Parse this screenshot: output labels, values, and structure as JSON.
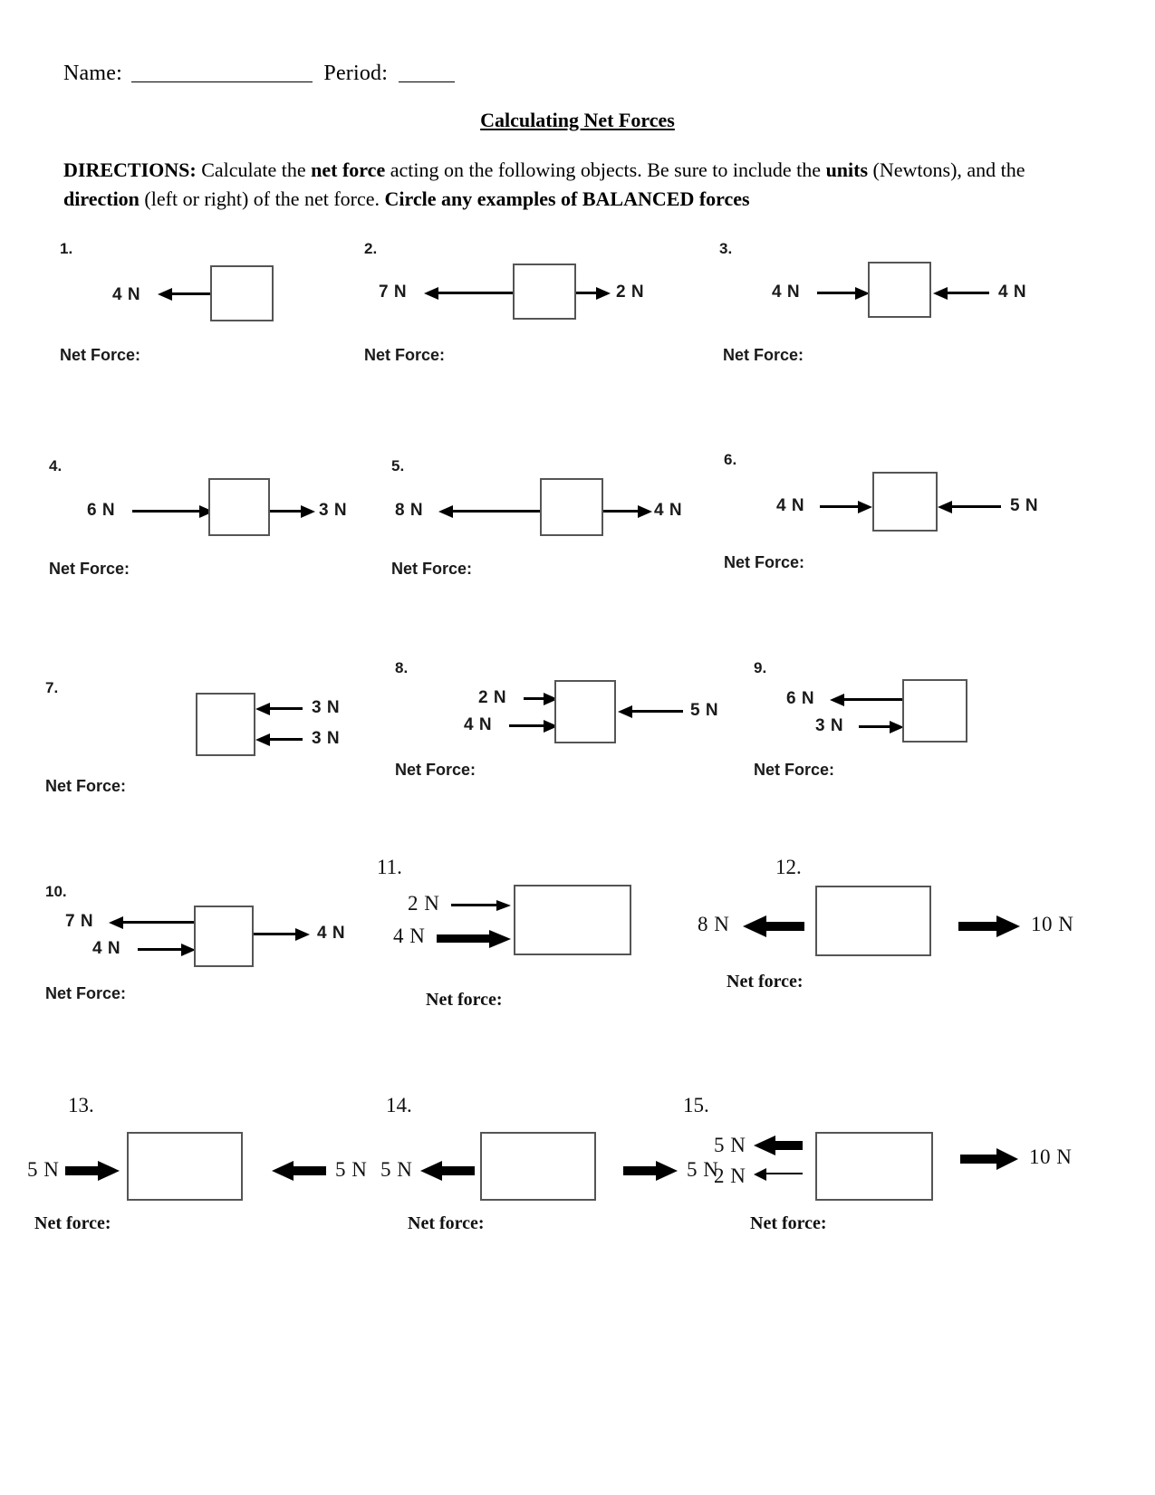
{
  "header": {
    "name_label": "Name:",
    "period_label": "Period:",
    "title": "Calculating Net Forces",
    "directions_prefix": "DIRECTIONS:",
    "directions_part1": " Calculate the ",
    "directions_bold1": "net force",
    "directions_part2": " acting on the following objects. Be sure to include the ",
    "directions_bold2": "units",
    "directions_part3": " (Newtons), and the ",
    "directions_bold3": "direction",
    "directions_part4": " (left or right) of the net force. ",
    "directions_bold4": "Circle any examples of BALANCED forces"
  },
  "labels": {
    "net_force_caps": "Net Force:",
    "net_force_lower": "Net force:"
  },
  "problems": [
    {
      "number": "1.",
      "style": "sans",
      "net_force_label": "Net Force:",
      "forces": [
        {
          "magnitude": "4 N",
          "direction": "left",
          "side": "left",
          "position": "outward"
        }
      ]
    },
    {
      "number": "2.",
      "style": "sans",
      "net_force_label": "Net Force:",
      "forces": [
        {
          "magnitude": "7 N",
          "direction": "left",
          "side": "left",
          "position": "outward"
        },
        {
          "magnitude": "2 N",
          "direction": "right",
          "side": "right",
          "position": "outward"
        }
      ]
    },
    {
      "number": "3.",
      "style": "sans",
      "net_force_label": "Net Force:",
      "forces": [
        {
          "magnitude": "4 N",
          "direction": "right",
          "side": "left",
          "position": "inward"
        },
        {
          "magnitude": "4 N",
          "direction": "left",
          "side": "right",
          "position": "inward"
        }
      ]
    },
    {
      "number": "4.",
      "style": "sans",
      "net_force_label": "Net Force:",
      "forces": [
        {
          "magnitude": "6 N",
          "direction": "right",
          "side": "left",
          "position": "inward"
        },
        {
          "magnitude": "3 N",
          "direction": "right",
          "side": "right",
          "position": "outward"
        }
      ]
    },
    {
      "number": "5.",
      "style": "sans",
      "net_force_label": "Net Force:",
      "forces": [
        {
          "magnitude": "8 N",
          "direction": "left",
          "side": "left",
          "position": "outward"
        },
        {
          "magnitude": "4 N",
          "direction": "right",
          "side": "right",
          "position": "outward"
        }
      ]
    },
    {
      "number": "6.",
      "style": "sans",
      "net_force_label": "Net Force:",
      "forces": [
        {
          "magnitude": "4 N",
          "direction": "right",
          "side": "left",
          "position": "inward"
        },
        {
          "magnitude": "5 N",
          "direction": "left",
          "side": "right",
          "position": "inward"
        }
      ]
    },
    {
      "number": "7.",
      "style": "sans",
      "net_force_label": "Net Force:",
      "forces": [
        {
          "magnitude": "3 N",
          "direction": "left",
          "side": "right",
          "position": "inward"
        },
        {
          "magnitude": "3 N",
          "direction": "left",
          "side": "right",
          "position": "inward"
        }
      ]
    },
    {
      "number": "8.",
      "style": "sans",
      "net_force_label": "Net Force:",
      "forces": [
        {
          "magnitude": "2 N",
          "direction": "right",
          "side": "left",
          "position": "inward"
        },
        {
          "magnitude": "4 N",
          "direction": "right",
          "side": "left",
          "position": "inward"
        },
        {
          "magnitude": "5 N",
          "direction": "left",
          "side": "right",
          "position": "inward"
        }
      ]
    },
    {
      "number": "9.",
      "style": "sans",
      "net_force_label": "Net Force:",
      "forces": [
        {
          "magnitude": "6 N",
          "direction": "left",
          "side": "left",
          "position": "outward"
        },
        {
          "magnitude": "3 N",
          "direction": "right",
          "side": "left",
          "position": "inward"
        }
      ]
    },
    {
      "number": "10.",
      "style": "sans",
      "net_force_label": "Net Force:",
      "forces": [
        {
          "magnitude": "7 N",
          "direction": "left",
          "side": "left",
          "position": "outward"
        },
        {
          "magnitude": "4 N",
          "direction": "right",
          "side": "left",
          "position": "inward"
        },
        {
          "magnitude": "4 N",
          "direction": "right",
          "side": "right",
          "position": "outward"
        }
      ]
    },
    {
      "number": "11.",
      "style": "serif",
      "net_force_label": "Net force:",
      "forces": [
        {
          "magnitude": "2 N",
          "direction": "right",
          "side": "left",
          "position": "inward"
        },
        {
          "magnitude": "4 N",
          "direction": "right",
          "side": "left",
          "position": "inward"
        }
      ]
    },
    {
      "number": "12.",
      "style": "serif",
      "net_force_label": "Net force:",
      "forces": [
        {
          "magnitude": "8 N",
          "direction": "left",
          "side": "left",
          "position": "outward"
        },
        {
          "magnitude": "10 N",
          "direction": "right",
          "side": "right",
          "position": "outward"
        }
      ]
    },
    {
      "number": "13.",
      "style": "serif",
      "net_force_label": "Net force:",
      "forces": [
        {
          "magnitude": "5 N",
          "direction": "right",
          "side": "left",
          "position": "inward"
        },
        {
          "magnitude": "5 N",
          "direction": "left",
          "side": "right",
          "position": "inward"
        }
      ]
    },
    {
      "number": "14.",
      "style": "serif",
      "net_force_label": "Net force:",
      "forces": [
        {
          "magnitude": "5 N",
          "direction": "left",
          "side": "left",
          "position": "outward"
        },
        {
          "magnitude": "5 N",
          "direction": "right",
          "side": "right",
          "position": "outward"
        }
      ]
    },
    {
      "number": "15.",
      "style": "serif",
      "net_force_label": "Net force:",
      "forces": [
        {
          "magnitude": "5 N",
          "direction": "left",
          "side": "left",
          "position": "outward"
        },
        {
          "magnitude": "2 N",
          "direction": "left",
          "side": "left",
          "position": "outward"
        },
        {
          "magnitude": "10 N",
          "direction": "right",
          "side": "right",
          "position": "outward"
        }
      ]
    }
  ]
}
